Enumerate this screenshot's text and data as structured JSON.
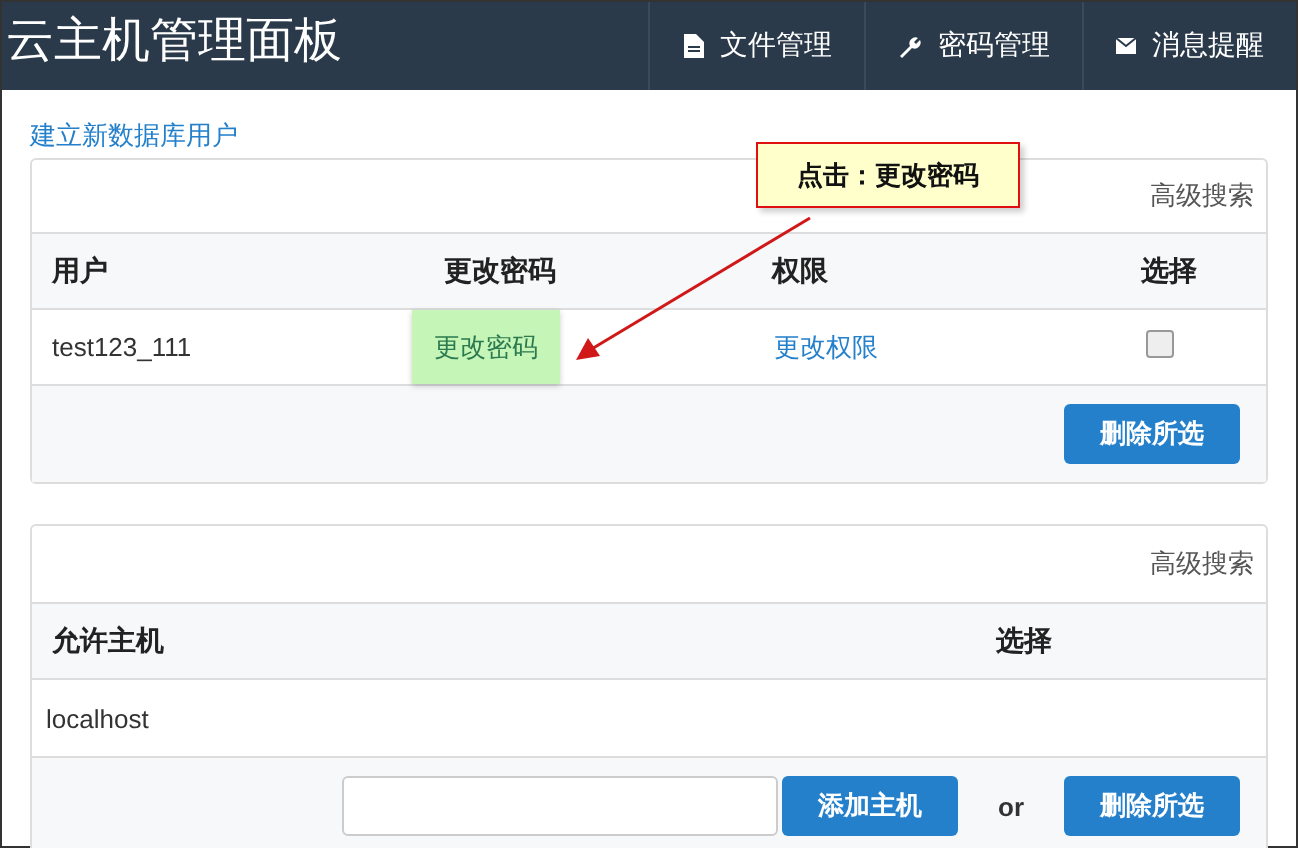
{
  "header": {
    "title": "云主机管理面板",
    "nav": [
      {
        "kind": "file",
        "label": "文件管理"
      },
      {
        "kind": "wrench",
        "label": "密码管理"
      },
      {
        "kind": "mail",
        "label": "消息提醒"
      }
    ]
  },
  "create_link": "建立新数据库用户",
  "annotation": {
    "text": "点击：更改密码"
  },
  "users_panel": {
    "search_link": "高级搜索",
    "columns": [
      "用户",
      "更改密码",
      "权限",
      "选择"
    ],
    "rows": [
      {
        "user": "test123_111",
        "password_link": "更改密码",
        "highlighted": true,
        "permission_link": "更改权限",
        "checked": false
      }
    ],
    "delete_button": "删除所选"
  },
  "hosts_panel": {
    "search_link": "高级搜索",
    "columns": [
      "允许主机",
      "选择"
    ],
    "rows": [
      {
        "host": "localhost"
      }
    ],
    "add_button": "添加主机",
    "or_text": "or",
    "delete_button": "删除所选"
  }
}
